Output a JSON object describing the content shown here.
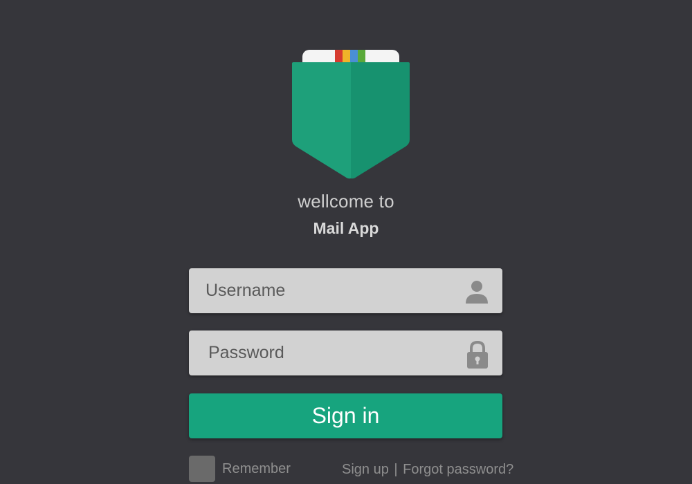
{
  "header": {
    "welcome_text": "wellcome to",
    "app_name": "Mail App",
    "logo_icon": "mail-pocket-logo-icon"
  },
  "form": {
    "username": {
      "placeholder": "Username",
      "value": "",
      "icon": "user-icon"
    },
    "password": {
      "placeholder": "Password",
      "value": "",
      "icon": "lock-icon"
    },
    "signin_label": "Sign in",
    "remember_label": "Remember",
    "remember_checked": false,
    "signup_label": "Sign up",
    "separator": "|",
    "forgot_label": "Forgot password?"
  },
  "colors": {
    "background": "#36363b",
    "accent": "#17a47e",
    "input_bg": "#d2d2d2",
    "icon_gray": "#8a8a8a"
  }
}
